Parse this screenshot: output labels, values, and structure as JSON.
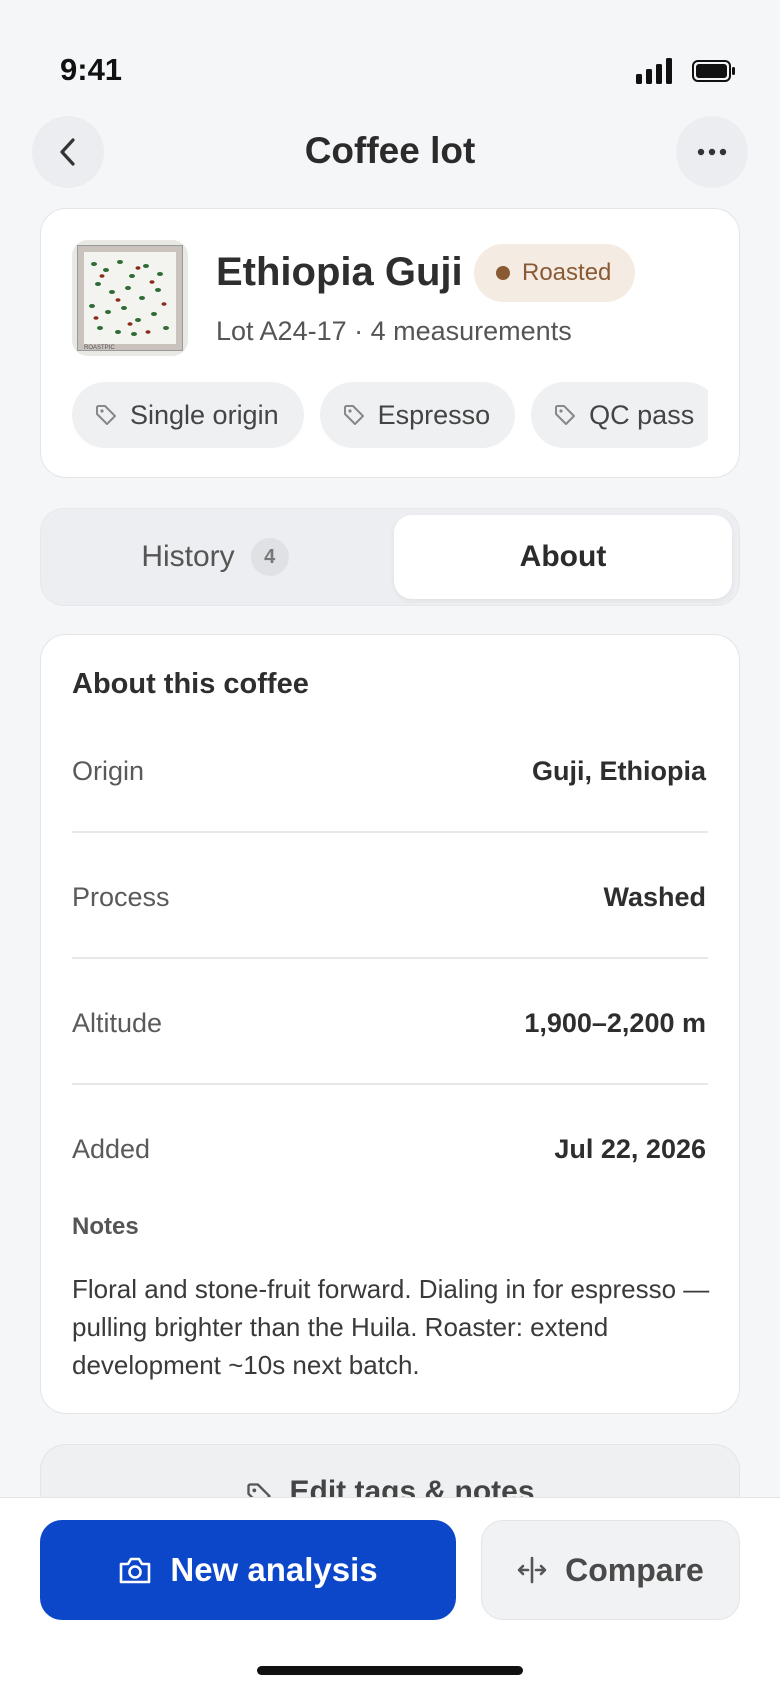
{
  "status_bar": {
    "time": "9:41",
    "icons": [
      "cellular-signal-icon",
      "battery-icon"
    ]
  },
  "header": {
    "title": "Coffee lot",
    "back_icon": "chevron-left-icon",
    "more_icon": "more-horizontal-icon"
  },
  "lot": {
    "name": "Ethiopia Guji",
    "status": "Roasted",
    "status_color": "#8a5a35",
    "meta": "Lot A24-17 · 4 measurements",
    "thumbnail_label": "ROASTPIC",
    "tags": [
      "Single origin",
      "Espresso",
      "QC pass"
    ],
    "tag_icon": "tag-icon"
  },
  "tabs": {
    "history_label": "History",
    "history_count": "4",
    "about_label": "About",
    "selected": "About"
  },
  "about": {
    "title": "About this coffee",
    "rows": [
      {
        "label": "Origin",
        "value": "Guji, Ethiopia"
      },
      {
        "label": "Process",
        "value": "Washed"
      },
      {
        "label": "Altitude",
        "value": "1,900–2,200 m"
      },
      {
        "label": "Added",
        "value": "Jul 22, 2026"
      }
    ],
    "notes_label": "Notes",
    "notes": "Floral and stone-fruit forward. Dialing in for espresso — pulling brighter than the Huila. Roaster: extend development ~10s next batch."
  },
  "actions": {
    "edit_label": "Edit tags & notes",
    "new_analysis_label": "New analysis",
    "compare_label": "Compare",
    "primary_color": "#0d47c9"
  }
}
